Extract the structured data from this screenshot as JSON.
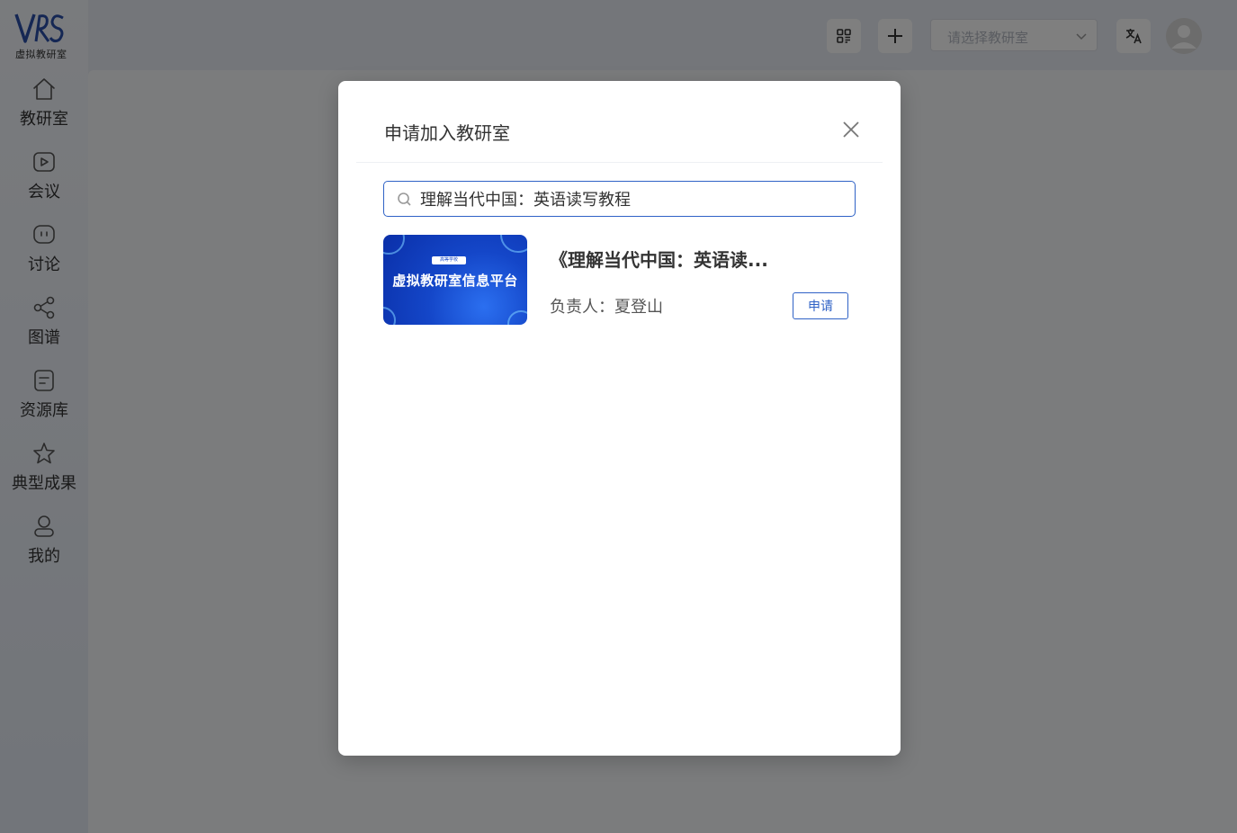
{
  "app": {
    "logo_mark": "VRS",
    "logo_text": "虚拟教研室"
  },
  "sidebar": {
    "items": [
      {
        "label": "教研室",
        "icon": "home-icon"
      },
      {
        "label": "会议",
        "icon": "video-play-icon"
      },
      {
        "label": "讨论",
        "icon": "chat-icon"
      },
      {
        "label": "图谱",
        "icon": "share-graph-icon"
      },
      {
        "label": "资源库",
        "icon": "document-icon"
      },
      {
        "label": "典型成果",
        "icon": "star-icon"
      },
      {
        "label": "我的",
        "icon": "user-icon"
      }
    ]
  },
  "header": {
    "lab_select_placeholder": "请选择教研室",
    "icons": [
      "grid-icon",
      "plus-icon",
      "chevron-down-icon",
      "translate-icon",
      "avatar"
    ]
  },
  "modal": {
    "title": "申请加入教研室",
    "search_value": "理解当代中国：英语读写教程",
    "results": [
      {
        "thumb_tag": "高等学校",
        "thumb_title": "虚拟教研室信息平台",
        "title": "《理解当代中国：英语读...",
        "owner": "负责人：夏登山",
        "apply_label": "申请"
      }
    ]
  },
  "colors": {
    "accent": "#2f62c6",
    "overlay": "rgba(0,0,0,0.5)"
  }
}
